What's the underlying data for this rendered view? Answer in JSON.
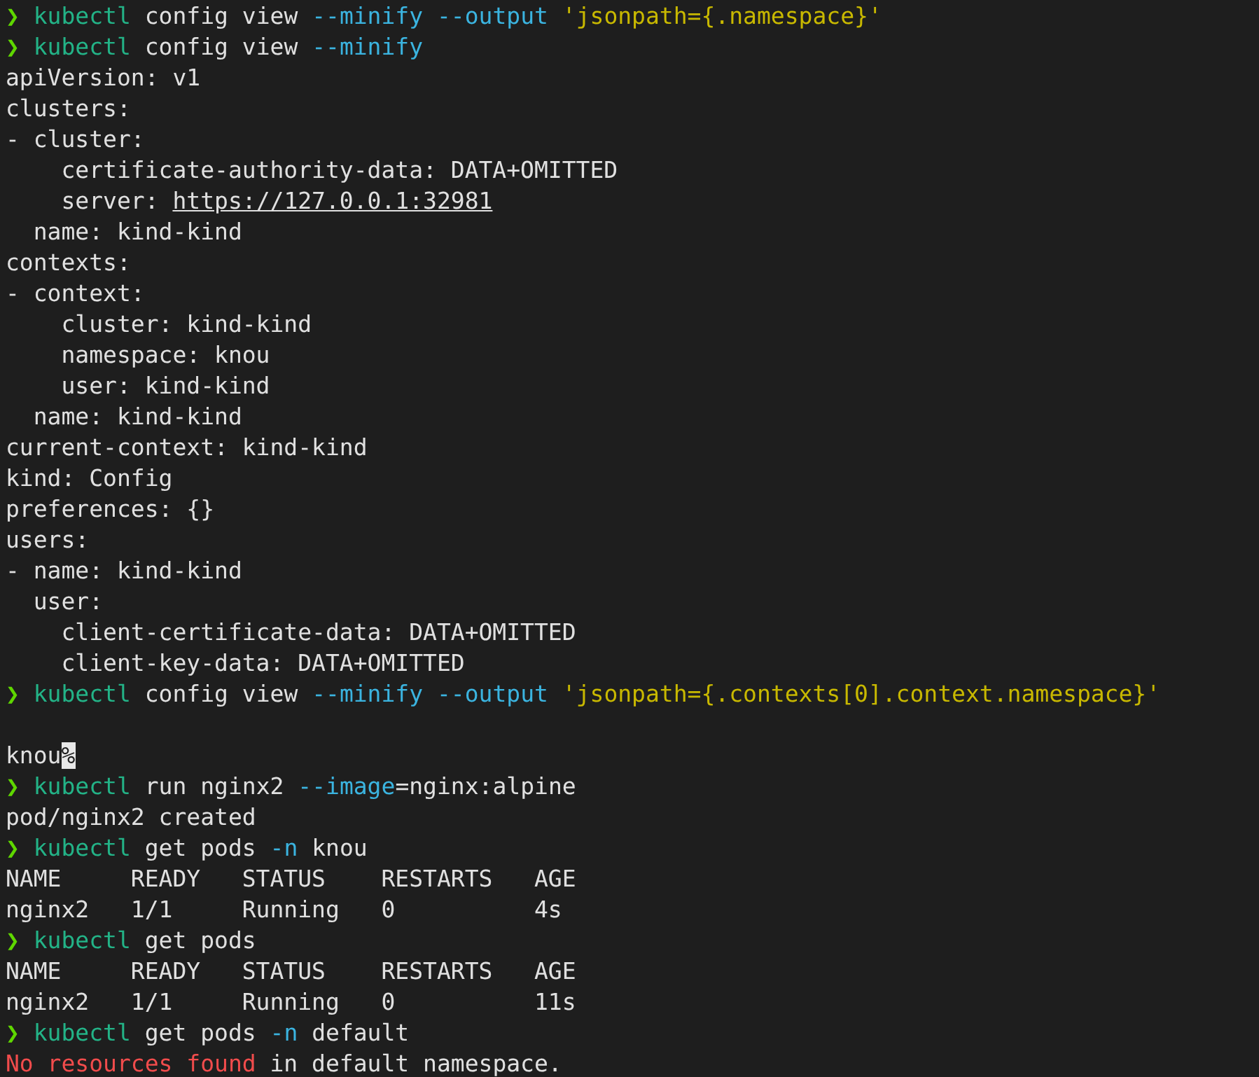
{
  "terminal": {
    "lines": [
      {
        "segments": [
          {
            "kind": "prompt",
            "text": "❯"
          },
          {
            "kind": "program",
            "text": " kubectl"
          },
          {
            "kind": "plain",
            "text": " config view"
          },
          {
            "kind": "flag",
            "text": " --minify --output"
          },
          {
            "kind": "string",
            "text": " 'jsonpath={.namespace}'"
          }
        ]
      },
      {
        "segments": [
          {
            "kind": "prompt",
            "text": "❯"
          },
          {
            "kind": "program",
            "text": " kubectl"
          },
          {
            "kind": "plain",
            "text": " config view"
          },
          {
            "kind": "flag",
            "text": " --minify"
          }
        ]
      },
      {
        "segments": [
          {
            "kind": "plain",
            "text": "apiVersion: v1"
          }
        ]
      },
      {
        "segments": [
          {
            "kind": "plain",
            "text": "clusters:"
          }
        ]
      },
      {
        "segments": [
          {
            "kind": "plain",
            "text": "- cluster:"
          }
        ]
      },
      {
        "segments": [
          {
            "kind": "plain",
            "text": "    certificate-authority-data: DATA+OMITTED"
          }
        ]
      },
      {
        "segments": [
          {
            "kind": "plain",
            "text": "    server: "
          },
          {
            "kind": "link",
            "text": "https://127.0.0.1:32981"
          }
        ]
      },
      {
        "segments": [
          {
            "kind": "plain",
            "text": "  name: kind-kind"
          }
        ]
      },
      {
        "segments": [
          {
            "kind": "plain",
            "text": "contexts:"
          }
        ]
      },
      {
        "segments": [
          {
            "kind": "plain",
            "text": "- context:"
          }
        ]
      },
      {
        "segments": [
          {
            "kind": "plain",
            "text": "    cluster: kind-kind"
          }
        ]
      },
      {
        "segments": [
          {
            "kind": "plain",
            "text": "    namespace: knou"
          }
        ]
      },
      {
        "segments": [
          {
            "kind": "plain",
            "text": "    user: kind-kind"
          }
        ]
      },
      {
        "segments": [
          {
            "kind": "plain",
            "text": "  name: kind-kind"
          }
        ]
      },
      {
        "segments": [
          {
            "kind": "plain",
            "text": "current-context: kind-kind"
          }
        ]
      },
      {
        "segments": [
          {
            "kind": "plain",
            "text": "kind: Config"
          }
        ]
      },
      {
        "segments": [
          {
            "kind": "plain",
            "text": "preferences: {}"
          }
        ]
      },
      {
        "segments": [
          {
            "kind": "plain",
            "text": "users:"
          }
        ]
      },
      {
        "segments": [
          {
            "kind": "plain",
            "text": "- name: kind-kind"
          }
        ]
      },
      {
        "segments": [
          {
            "kind": "plain",
            "text": "  user:"
          }
        ]
      },
      {
        "segments": [
          {
            "kind": "plain",
            "text": "    client-certificate-data: DATA+OMITTED"
          }
        ]
      },
      {
        "segments": [
          {
            "kind": "plain",
            "text": "    client-key-data: DATA+OMITTED"
          }
        ]
      },
      {
        "segments": [
          {
            "kind": "prompt",
            "text": "❯"
          },
          {
            "kind": "program",
            "text": " kubectl"
          },
          {
            "kind": "plain",
            "text": " config view"
          },
          {
            "kind": "flag",
            "text": " --minify --output"
          },
          {
            "kind": "string",
            "text": " 'jsonpath={.contexts[0].context.namespace}'"
          }
        ]
      },
      {
        "blank_before": true,
        "segments": [
          {
            "kind": "plain",
            "text": "knou"
          },
          {
            "kind": "cursor",
            "text": "%"
          }
        ]
      },
      {
        "segments": [
          {
            "kind": "prompt",
            "text": "❯"
          },
          {
            "kind": "program",
            "text": " kubectl"
          },
          {
            "kind": "plain",
            "text": " run nginx2"
          },
          {
            "kind": "flag",
            "text": " --image"
          },
          {
            "kind": "plain",
            "text": "=nginx:alpine"
          }
        ]
      },
      {
        "segments": [
          {
            "kind": "plain",
            "text": "pod/nginx2 created"
          }
        ]
      },
      {
        "segments": [
          {
            "kind": "prompt",
            "text": "❯"
          },
          {
            "kind": "program",
            "text": " kubectl"
          },
          {
            "kind": "plain",
            "text": " get pods"
          },
          {
            "kind": "flag",
            "text": " -n"
          },
          {
            "kind": "plain",
            "text": " knou"
          }
        ]
      },
      {
        "segments": [
          {
            "kind": "plain",
            "text": "NAME     READY   STATUS    RESTARTS   AGE"
          }
        ]
      },
      {
        "segments": [
          {
            "kind": "plain",
            "text": "nginx2   1/1     Running   0          4s"
          }
        ]
      },
      {
        "segments": [
          {
            "kind": "prompt",
            "text": "❯"
          },
          {
            "kind": "program",
            "text": " kubectl"
          },
          {
            "kind": "plain",
            "text": " get pods"
          }
        ]
      },
      {
        "segments": [
          {
            "kind": "plain",
            "text": "NAME     READY   STATUS    RESTARTS   AGE"
          }
        ]
      },
      {
        "segments": [
          {
            "kind": "plain",
            "text": "nginx2   1/1     Running   0          11s"
          }
        ]
      },
      {
        "segments": [
          {
            "kind": "prompt",
            "text": "❯"
          },
          {
            "kind": "program",
            "text": " kubectl"
          },
          {
            "kind": "plain",
            "text": " get pods"
          },
          {
            "kind": "flag",
            "text": " -n"
          },
          {
            "kind": "plain",
            "text": " default"
          }
        ]
      },
      {
        "segments": [
          {
            "kind": "error",
            "text": "No resources found"
          },
          {
            "kind": "plain",
            "text": " in default namespace."
          }
        ]
      }
    ]
  }
}
